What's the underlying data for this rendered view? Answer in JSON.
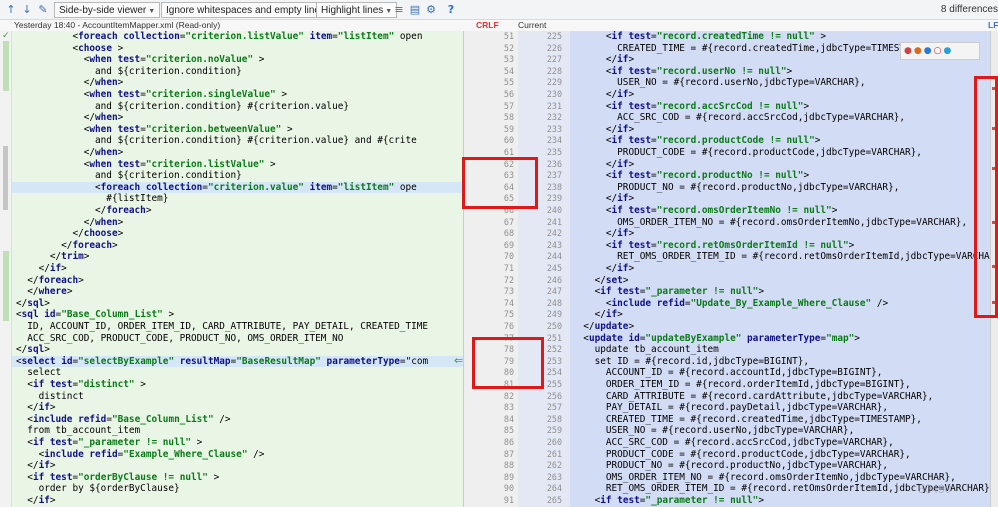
{
  "toolbar": {
    "viewer_label": "Side-by-side viewer",
    "whitespace_label": "Ignore whitespaces and empty lines",
    "highlight_label": "Highlight lines",
    "help_label": "?",
    "diff_count": "8 differences"
  },
  "header": {
    "left_title": "Yesterday 18:40 - AccountItemMapper.xml (Read-only)",
    "line_sep": "CRLF",
    "right_title": "Current",
    "right_hint": "LF"
  },
  "left_lines": [
    {
      "code": "          <foreach collection=\"criterion.listValue\" item=\"listItem\" open",
      "hl": false
    },
    {
      "code": "          <choose >",
      "hl": false
    },
    {
      "code": "            <when test=\"criterion.noValue\" >",
      "hl": false
    },
    {
      "code": "              and ${criterion.condition}",
      "hl": false
    },
    {
      "code": "            </when>",
      "hl": false
    },
    {
      "code": "            <when test=\"criterion.singleValue\" >",
      "hl": false
    },
    {
      "code": "              and ${criterion.condition} #{criterion.value}",
      "hl": false
    },
    {
      "code": "            </when>",
      "hl": false
    },
    {
      "code": "            <when test=\"criterion.betweenValue\" >",
      "hl": false
    },
    {
      "code": "              and ${criterion.condition} #{criterion.value} and #{crite",
      "hl": false
    },
    {
      "code": "            </when>",
      "hl": false
    },
    {
      "code": "            <when test=\"criterion.listValue\" >",
      "hl": false
    },
    {
      "code": "              and ${criterion.condition}",
      "hl": false
    },
    {
      "code": "              <foreach collection=\"criterion.value\" item=\"listItem\" ope",
      "hl": true
    },
    {
      "code": "                #{listItem}",
      "hl": false
    },
    {
      "code": "              </foreach>",
      "hl": false
    },
    {
      "code": "            </when>",
      "hl": false
    },
    {
      "code": "          </choose>",
      "hl": false
    },
    {
      "code": "        </foreach>",
      "hl": false
    },
    {
      "code": "      </trim>",
      "hl": false
    },
    {
      "code": "    </if>",
      "hl": false
    },
    {
      "code": "  </foreach>",
      "hl": false
    },
    {
      "code": "  </where>",
      "hl": false
    },
    {
      "code": "</sql>",
      "hl": false
    },
    {
      "code": "<sql id=\"Base_Column_List\" >",
      "hl": false
    },
    {
      "code": "  ID, ACCOUNT_ID, ORDER_ITEM_ID, CARD_ATTRIBUTE, PAY_DETAIL, CREATED_TIME",
      "hl": false
    },
    {
      "code": "  ACC_SRC_COD, PRODUCT_CODE, PRODUCT_NO, OMS_ORDER_ITEM_NO",
      "hl": false
    },
    {
      "code": "</sql>",
      "hl": false
    },
    {
      "code": "<select id=\"selectByExample\" resultMap=\"BaseResultMap\" parameterType=\"com",
      "hl": true
    },
    {
      "code": "  select",
      "hl": false
    },
    {
      "code": "  <if test=\"distinct\" >",
      "hl": false
    },
    {
      "code": "    distinct",
      "hl": false
    },
    {
      "code": "  </if>",
      "hl": false
    },
    {
      "code": "  <include refid=\"Base_Column_List\" />",
      "hl": false
    },
    {
      "code": "  from tb_account_item",
      "hl": false
    },
    {
      "code": "  <if test=\"_parameter != null\" >",
      "hl": false
    },
    {
      "code": "    <include refid=\"Example_Where_Clause\" />",
      "hl": false
    },
    {
      "code": "  </if>",
      "hl": false
    },
    {
      "code": "  <if test=\"orderByClause != null\" >",
      "hl": false
    },
    {
      "code": "    order by ${orderByClause}",
      "hl": false
    },
    {
      "code": "  </if>",
      "hl": false
    }
  ],
  "left_numbers": [
    "51",
    "52",
    "53",
    "54",
    "55",
    "56",
    "57",
    "58",
    "59",
    "60",
    "61",
    "62",
    "63",
    "64",
    "65",
    "66",
    "67",
    "68",
    "69",
    "70",
    "71",
    "72",
    "73",
    "74",
    "75",
    "76",
    "77",
    "78",
    "79",
    "80",
    "81",
    "82",
    "83",
    "84",
    "85",
    "86",
    "87",
    "88",
    "89",
    "90",
    "91"
  ],
  "right_numbers": [
    "225",
    "226",
    "227",
    "228",
    "229",
    "230",
    "231",
    "232",
    "233",
    "234",
    "235",
    "236",
    "237",
    "238",
    "239",
    "240",
    "241",
    "242",
    "243",
    "244",
    "245",
    "246",
    "247",
    "248",
    "249",
    "250",
    "251",
    "252",
    "253",
    "254",
    "255",
    "256",
    "257",
    "258",
    "259",
    "260",
    "261",
    "262",
    "263",
    "264",
    "265"
  ],
  "right_lines": [
    {
      "code": "      <if test=\"record.createdTime != null\" >",
      "hl": false
    },
    {
      "code": "        CREATED_TIME = #{record.createdTime,jdbcType=TIMESTAMP},",
      "hl": false
    },
    {
      "code": "      </if>",
      "hl": false
    },
    {
      "code": "      <if test=\"record.userNo != null\">",
      "hl": false
    },
    {
      "code": "        USER_NO = #{record.userNo,jdbcType=VARCHAR},",
      "hl": false
    },
    {
      "code": "      </if>",
      "hl": false
    },
    {
      "code": "      <if test=\"record.accSrcCod != null\">",
      "hl": false
    },
    {
      "code": "        ACC_SRC_COD = #{record.accSrcCod,jdbcType=VARCHAR},",
      "hl": false
    },
    {
      "code": "      </if>",
      "hl": false
    },
    {
      "code": "      <if test=\"record.productCode != null\">",
      "hl": false
    },
    {
      "code": "        PRODUCT_CODE = #{record.productCode,jdbcType=VARCHAR},",
      "hl": false
    },
    {
      "code": "      </if>",
      "hl": false
    },
    {
      "code": "      <if test=\"record.productNo != null\">",
      "hl": false
    },
    {
      "code": "        PRODUCT_NO = #{record.productNo,jdbcType=VARCHAR},",
      "hl": false
    },
    {
      "code": "      </if>",
      "hl": false
    },
    {
      "code": "      <if test=\"record.omsOrderItemNo != null\">",
      "hl": false
    },
    {
      "code": "        OMS_ORDER_ITEM_NO = #{record.omsOrderItemNo,jdbcType=VARCHAR},",
      "hl": false
    },
    {
      "code": "      </if>",
      "hl": false
    },
    {
      "code": "      <if test=\"record.retOmsOrderItemId != null\">",
      "hl": false
    },
    {
      "code": "        RET_OMS_ORDER_ITEM_ID = #{record.retOmsOrderItemId,jdbcType=VARCHAR},",
      "hl": false
    },
    {
      "code": "      </if>",
      "hl": false
    },
    {
      "code": "    </set>",
      "hl": false
    },
    {
      "code": "    <if test=\"_parameter != null\">",
      "hl": false
    },
    {
      "code": "      <include refid=\"Update_By_Example_Where_Clause\" />",
      "hl": false
    },
    {
      "code": "    </if>",
      "hl": false
    },
    {
      "code": "  </update>",
      "hl": false
    },
    {
      "code": "  <update id=\"updateByExample\" parameterType=\"map\">",
      "hl": false
    },
    {
      "code": "    update tb_account_item",
      "hl": false
    },
    {
      "code": "    set ID = #{record.id,jdbcType=BIGINT},",
      "hl": false
    },
    {
      "code": "      ACCOUNT_ID = #{record.accountId,jdbcType=BIGINT},",
      "hl": false
    },
    {
      "code": "      ORDER_ITEM_ID = #{record.orderItemId,jdbcType=BIGINT},",
      "hl": false
    },
    {
      "code": "      CARD_ATTRIBUTE = #{record.cardAttribute,jdbcType=VARCHAR},",
      "hl": false
    },
    {
      "code": "      PAY_DETAIL = #{record.payDetail,jdbcType=VARCHAR},",
      "hl": false
    },
    {
      "code": "      CREATED_TIME = #{record.createdTime,jdbcType=TIMESTAMP},",
      "hl": false
    },
    {
      "code": "      USER_NO = #{record.userNo,jdbcType=VARCHAR},",
      "hl": false
    },
    {
      "code": "      ACC_SRC_COD = #{record.accSrcCod,jdbcType=VARCHAR},",
      "hl": false
    },
    {
      "code": "      PRODUCT_CODE = #{record.productCode,jdbcType=VARCHAR},",
      "hl": false
    },
    {
      "code": "      PRODUCT_NO = #{record.productNo,jdbcType=VARCHAR},",
      "hl": false
    },
    {
      "code": "      OMS_ORDER_ITEM_NO = #{record.omsOrderItemNo,jdbcType=VARCHAR},",
      "hl": false
    },
    {
      "code": "      RET_OMS_ORDER_ITEM_ID = #{record.retOmsOrderItemId,jdbcType=VARCHAR},",
      "hl": false
    },
    {
      "code": "    <if test=\"_parameter != null\">",
      "hl": false
    }
  ],
  "watermark": "50490",
  "colors": {
    "left_bg": "#e9f6e5",
    "right_bg": "#d2ddf5",
    "highlight": "#d5e7f7",
    "marker": "#e01818"
  }
}
